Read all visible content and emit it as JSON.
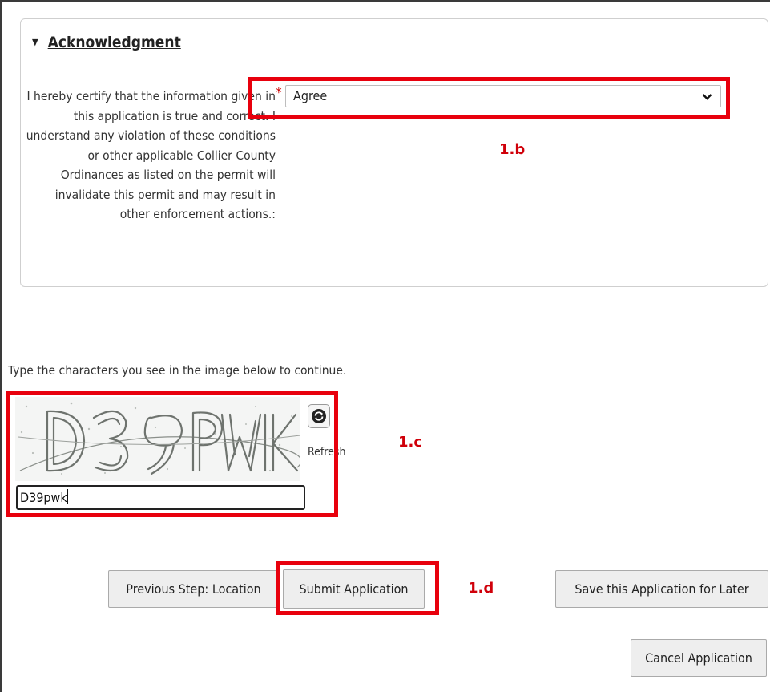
{
  "acknowledgment": {
    "section_title": "Acknowledgment",
    "certification_text": "I hereby certify that the information given in this application is true and correct. I understand any violation of these conditions or other applicable Collier County Ordinances as listed on the permit will invalidate this permit and may result in other enforcement actions.:",
    "required_marker": "*",
    "select_value": "Agree"
  },
  "captcha": {
    "instruction": "Type the characters you see in the image below to continue.",
    "image_text": "D39PWK",
    "refresh_label": "Refresh",
    "input_value": "D39pwk"
  },
  "buttons": {
    "previous_label": "Previous Step: Location",
    "submit_label": "Submit Application",
    "save_label": "Save this Application for Later",
    "cancel_label": "Cancel Application"
  },
  "annotations": {
    "b": "1.b",
    "c": "1.c",
    "d": "1.d"
  },
  "colors": {
    "highlight": "#e8000d",
    "annotation_text": "#d0000a",
    "required": "#cc0000"
  },
  "icons": [
    "triangle-down-icon",
    "chevron-down-icon",
    "refresh-icon"
  ]
}
